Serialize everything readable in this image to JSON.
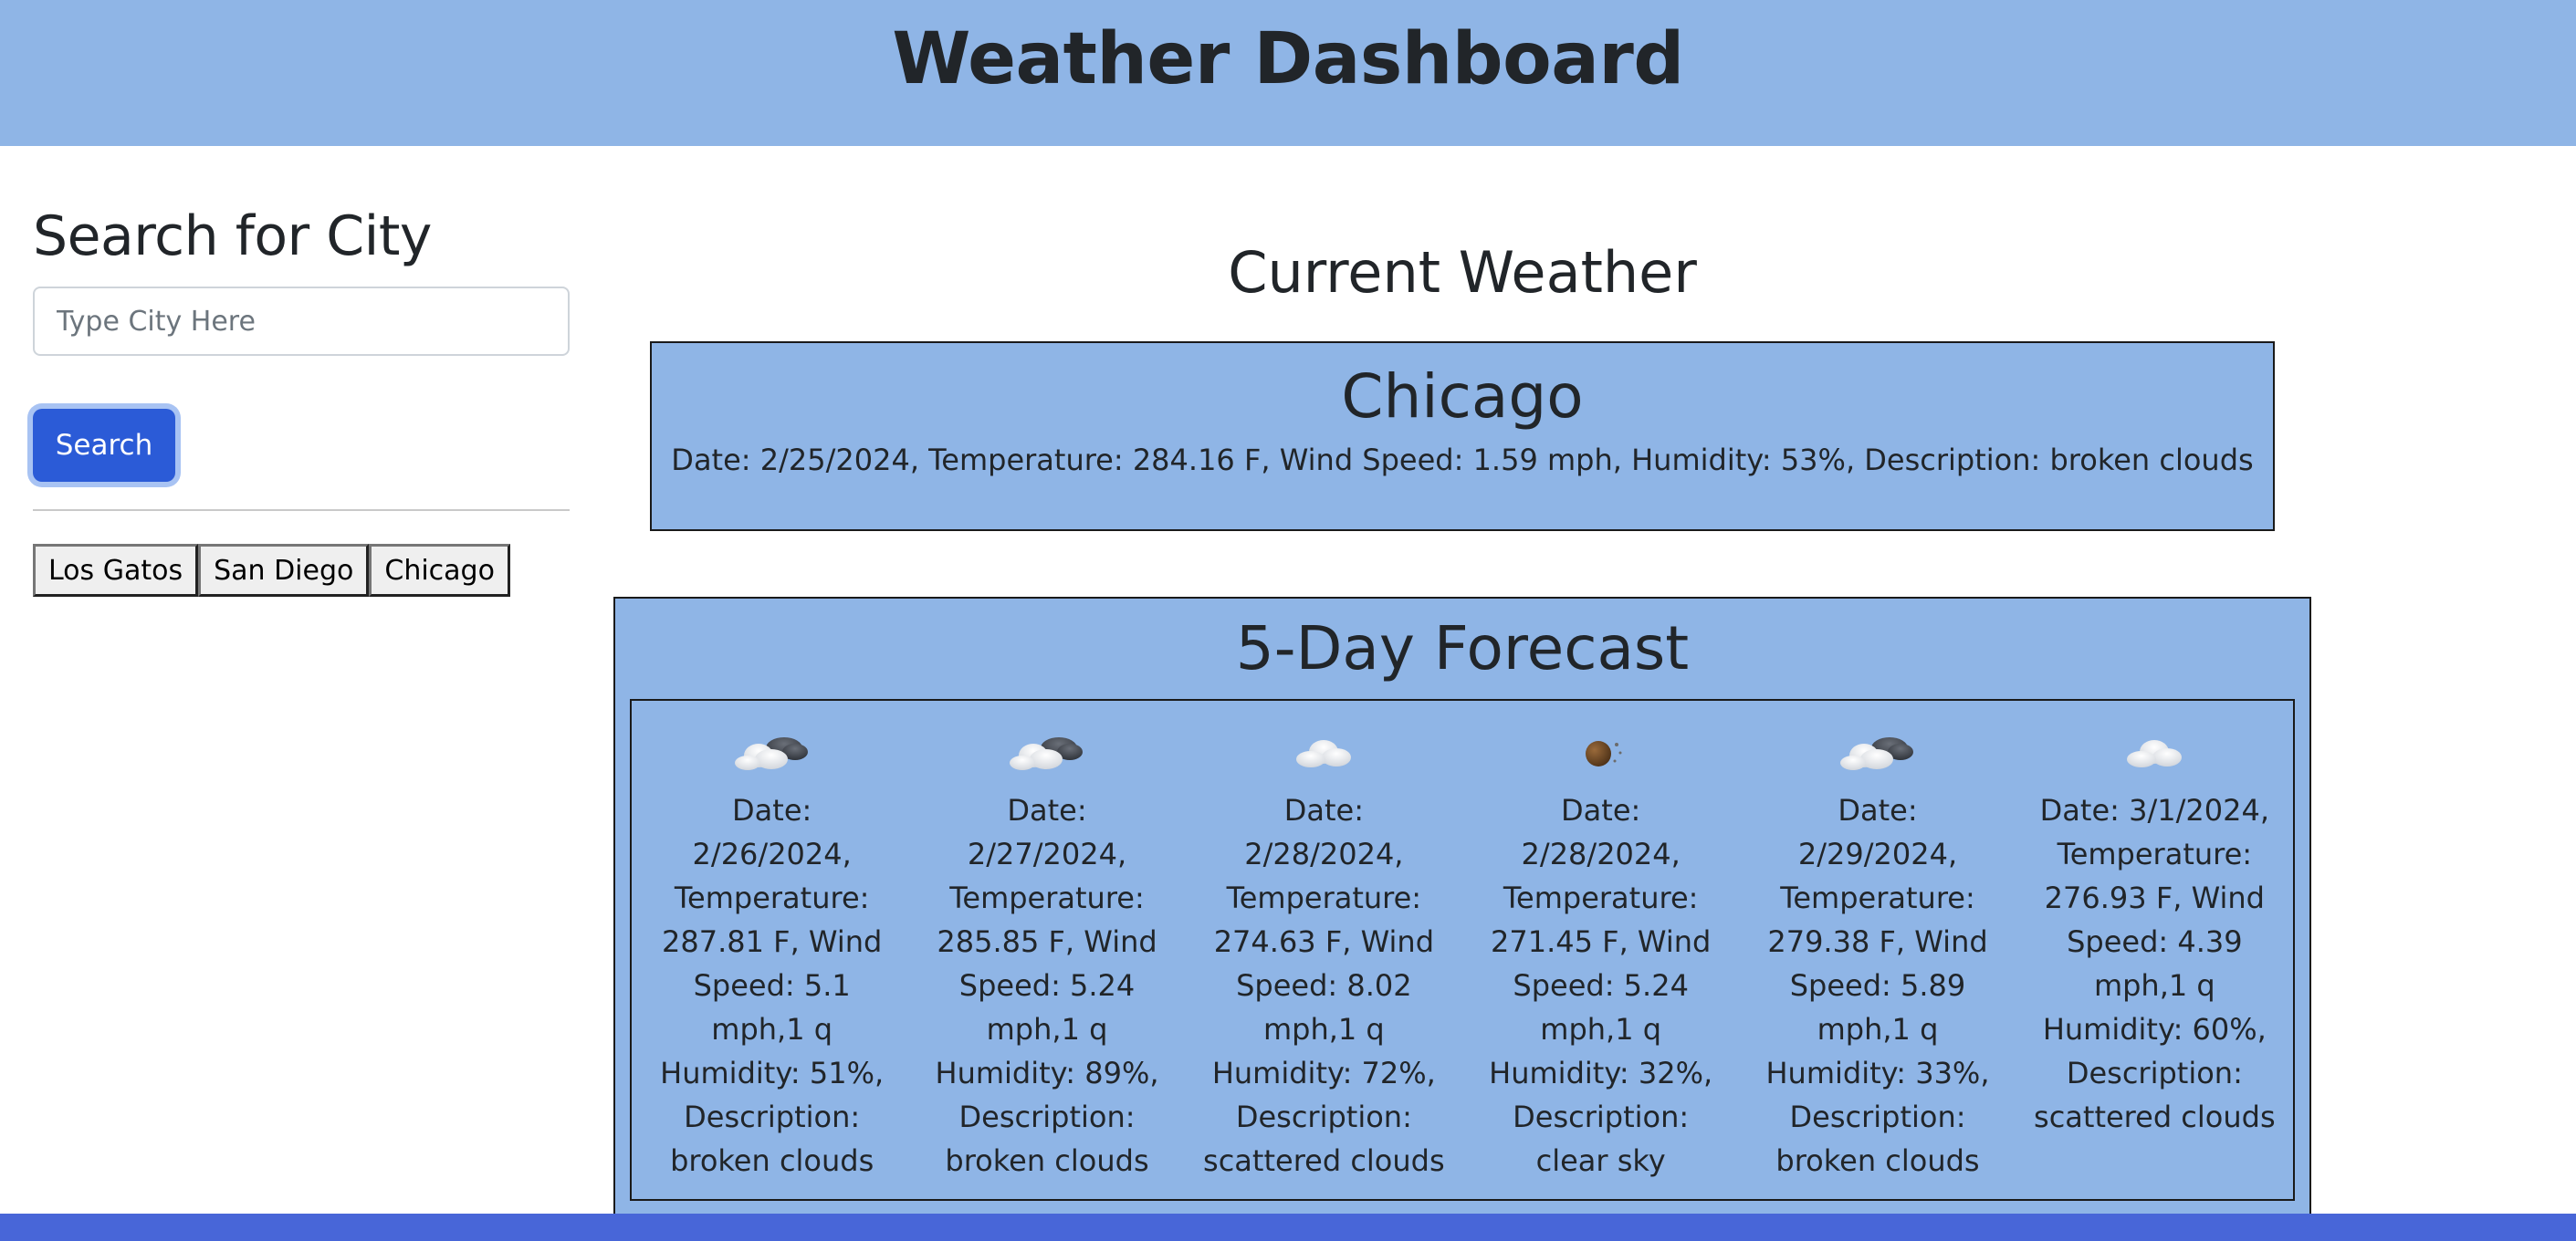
{
  "header": {
    "title": "Weather Dashboard"
  },
  "sidebar": {
    "heading": "Search for City",
    "search_placeholder": "Type City Here",
    "search_value": "",
    "search_button": "Search",
    "history": [
      "Los Gatos",
      "San Diego",
      "Chicago"
    ]
  },
  "current": {
    "section_title": "Current Weather",
    "city": "Chicago",
    "details": "Date: 2/25/2024, Temperature: 284.16 F, Wind Speed: 1.59 mph, Humidity: 53%, Description: broken clouds"
  },
  "forecast": {
    "title": "5-Day Forecast",
    "days": [
      {
        "icon": "broken-clouds-icon",
        "text": "Date: 2/26/2024, Temperature: 287.81 F, Wind Speed: 5.1 mph,1 q Humidity: 51%, Description: broken clouds"
      },
      {
        "icon": "broken-clouds-icon",
        "text": "Date: 2/27/2024, Temperature: 285.85 F, Wind Speed: 5.24 mph,1 q Humidity: 89%, Description: broken clouds"
      },
      {
        "icon": "scattered-clouds-icon",
        "text": "Date: 2/28/2024, Temperature: 274.63 F, Wind Speed: 8.02 mph,1 q Humidity: 72%, Description: scattered clouds"
      },
      {
        "icon": "clear-sky-night-icon",
        "text": "Date: 2/28/2024, Temperature: 271.45 F, Wind Speed: 5.24 mph,1 q Humidity: 32%, Description: clear sky"
      },
      {
        "icon": "broken-clouds-icon",
        "text": "Date: 2/29/2024, Temperature: 279.38 F, Wind Speed: 5.89 mph,1 q Humidity: 33%, Description: broken clouds"
      },
      {
        "icon": "scattered-clouds-icon",
        "text": "Date: 3/1/2024, Temperature: 276.93 F, Wind Speed: 4.39 mph,1 q Humidity: 60%, Description: scattered clouds"
      }
    ]
  },
  "colors": {
    "header_bg": "#8fb5e6",
    "card_bg": "#8fb5e6",
    "search_button_bg": "#2b5bd7",
    "footer_bar": "#4866d8"
  }
}
